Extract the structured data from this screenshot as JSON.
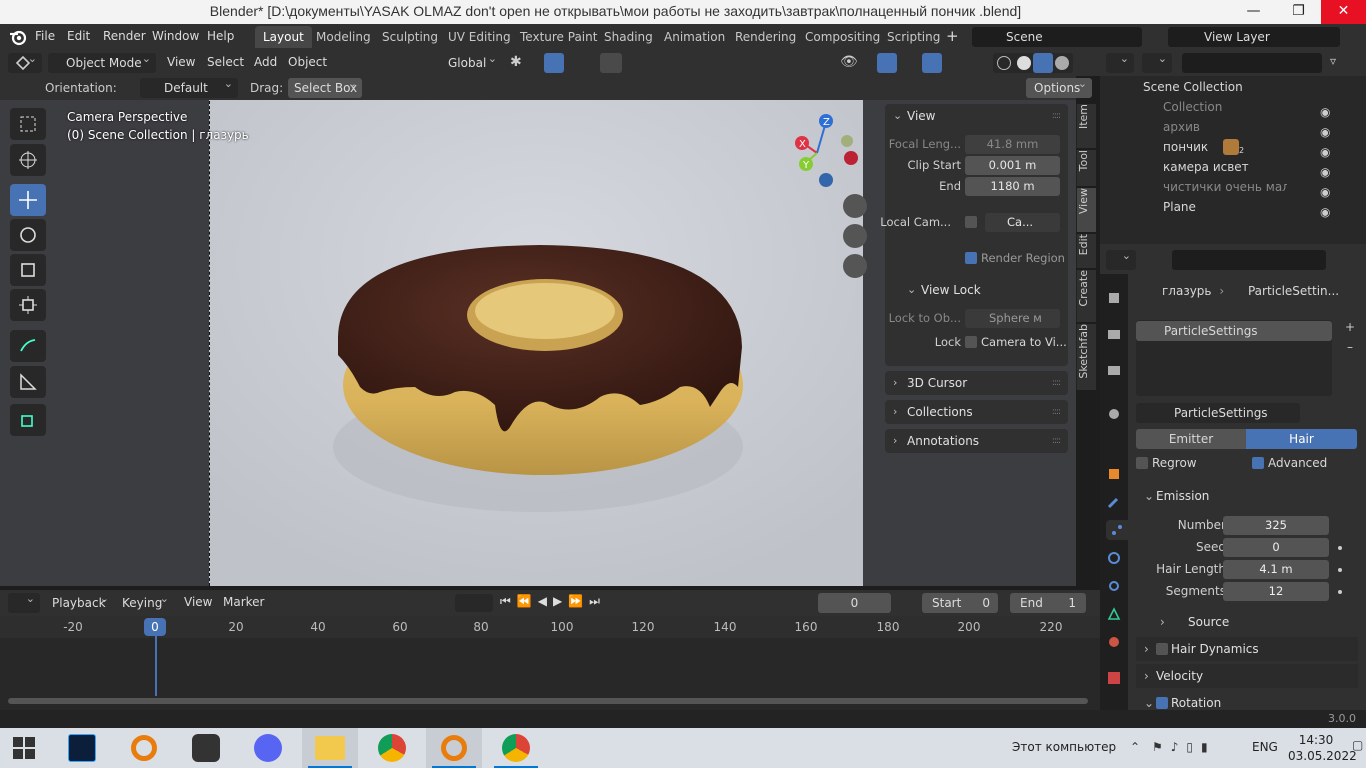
{
  "window": {
    "title": "Blender* [D:\\документы\\YASAK OLMAZ don't open не открывать\\мои работы не заходить\\завтрак\\полнаценный пончик  .blend]"
  },
  "menu": [
    "File",
    "Edit",
    "Render",
    "Window",
    "Help"
  ],
  "workspaces": [
    "Layout",
    "Modeling",
    "Sculpting",
    "UV Editing",
    "Texture Paint",
    "Shading",
    "Animation",
    "Rendering",
    "Compositing",
    "Scripting"
  ],
  "scene": {
    "name": "Scene",
    "view_layer": "View Layer"
  },
  "header": {
    "mode": "Object Mode",
    "view": "View",
    "select": "Select",
    "add": "Add",
    "object": "Object",
    "orientation_global": "Global"
  },
  "toolsettings": {
    "orientation_label": "Orientation:",
    "orientation_value": "Default",
    "drag_label": "Drag:",
    "drag_value": "Select Box",
    "options": "Options"
  },
  "viewport": {
    "line1": "Camera Perspective",
    "line2": "(0) Scene Collection | глазурь",
    "gizmo": {
      "x": "X",
      "y": "Y",
      "z": "Z"
    }
  },
  "npanel": {
    "view_title": "View",
    "focal_label": "Focal Leng...",
    "focal_value": "41.8 mm",
    "clip_start_label": "Clip Start",
    "clip_start_value": "0.001 m",
    "clip_end_label": "End",
    "clip_end_value": "1180 m",
    "local_cam_label": "Local Cam...",
    "local_cam_value": "Ca...",
    "render_region": "Render Region",
    "view_lock_title": "View Lock",
    "lock_to_label": "Lock to Ob...",
    "lock_to_value": "Sphere м",
    "lock_label": "Lock",
    "camera_to_view": "Camera to Vi...",
    "sections": [
      "3D Cursor",
      "Collections",
      "Annotations"
    ],
    "tabs": [
      "Item",
      "Tool",
      "View",
      "Edit",
      "Create",
      "Sketchfab"
    ]
  },
  "timeline": {
    "playback": "Playback",
    "keying": "Keying",
    "view": "View",
    "marker": "Marker",
    "current_frame": "0",
    "start_label": "Start",
    "start": "0",
    "end_label": "End",
    "end": "1",
    "ticks": [
      "-20",
      "0",
      "20",
      "40",
      "60",
      "80",
      "100",
      "120",
      "140",
      "160",
      "180",
      "200",
      "220"
    ]
  },
  "outliner": {
    "rows": [
      "Scene Collection",
      "Collection",
      "архив",
      "пончик",
      "камера исвет",
      "чистички очень маленьк",
      "Plane"
    ],
    "badge": "2"
  },
  "properties": {
    "breadcrumb_obj": "глазурь",
    "breadcrumb_ps": "ParticleSettin...",
    "slot": "ParticleSettings",
    "datablock": "ParticleSettings",
    "emitter": "Emitter",
    "hair": "Hair",
    "regrow": "Regrow",
    "advanced": "Advanced",
    "emission": "Emission",
    "fields": [
      {
        "label": "Number",
        "value": "325"
      },
      {
        "label": "Seed",
        "value": "0"
      },
      {
        "label": "Hair Length",
        "value": "4.1 m"
      },
      {
        "label": "Segments",
        "value": "12"
      }
    ],
    "source": "Source",
    "sections": [
      "Hair Dynamics",
      "Velocity",
      "Rotation"
    ]
  },
  "status": {
    "version": "3.0.0"
  },
  "taskbar": {
    "computer": "Этот компьютер",
    "lang": "ENG",
    "time": "14:30",
    "date": "03.05.2022"
  },
  "colors": {
    "accent": "#4772b3",
    "header": "#303030",
    "viewport_bg": "#c9ccd3",
    "frosting": "#3a1c15",
    "dough": "#d9b25a"
  }
}
